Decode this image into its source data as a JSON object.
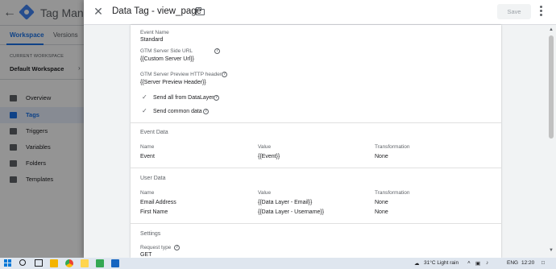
{
  "background_app": {
    "title": "Tag Manage",
    "tabs": [
      "Workspace",
      "Versions"
    ],
    "current_workspace_label": "CURRENT WORKSPACE",
    "workspace_name": "Default Workspace",
    "nav_items": [
      {
        "label": "Overview",
        "icon": "overview-icon"
      },
      {
        "label": "Tags",
        "icon": "tag-icon",
        "active": true
      },
      {
        "label": "Triggers",
        "icon": "trigger-icon"
      },
      {
        "label": "Variables",
        "icon": "variable-icon"
      },
      {
        "label": "Folders",
        "icon": "folder-icon"
      },
      {
        "label": "Templates",
        "icon": "template-icon"
      }
    ]
  },
  "panel": {
    "title": "Data Tag - view_page",
    "save_label": "Save",
    "fields": {
      "event_name_label": "Event Name",
      "event_name_value": "Standard",
      "server_url_label": "GTM Server Side URL",
      "server_url_value": "{{Custom Server Url}}",
      "preview_header_label": "GTM Server Preview HTTP header",
      "preview_header_value": "{{Server Preview Header}}",
      "send_all_label": "Send all from DataLayer",
      "send_common_label": "Send common data"
    },
    "event_data": {
      "title": "Event Data",
      "headers": [
        "Name",
        "Value",
        "Transformation"
      ],
      "rows": [
        [
          "Event",
          "{{Event}}",
          "None"
        ]
      ]
    },
    "user_data": {
      "title": "User Data",
      "headers": [
        "Name",
        "Value",
        "Transformation"
      ],
      "rows": [
        [
          "Email Address",
          "{{Data Layer - Email}}",
          "None"
        ],
        [
          "First Name",
          "{{Data Layer - Username}}",
          "None"
        ]
      ]
    },
    "settings": {
      "title": "Settings",
      "request_type_label": "Request type",
      "request_type_value": "GET"
    }
  },
  "taskbar": {
    "weather": "31°C  Light rain",
    "language": "ENG",
    "time": "12:20"
  },
  "colors": {
    "accent": "#1a73e8",
    "panel_bg": "#f1f3f4"
  }
}
